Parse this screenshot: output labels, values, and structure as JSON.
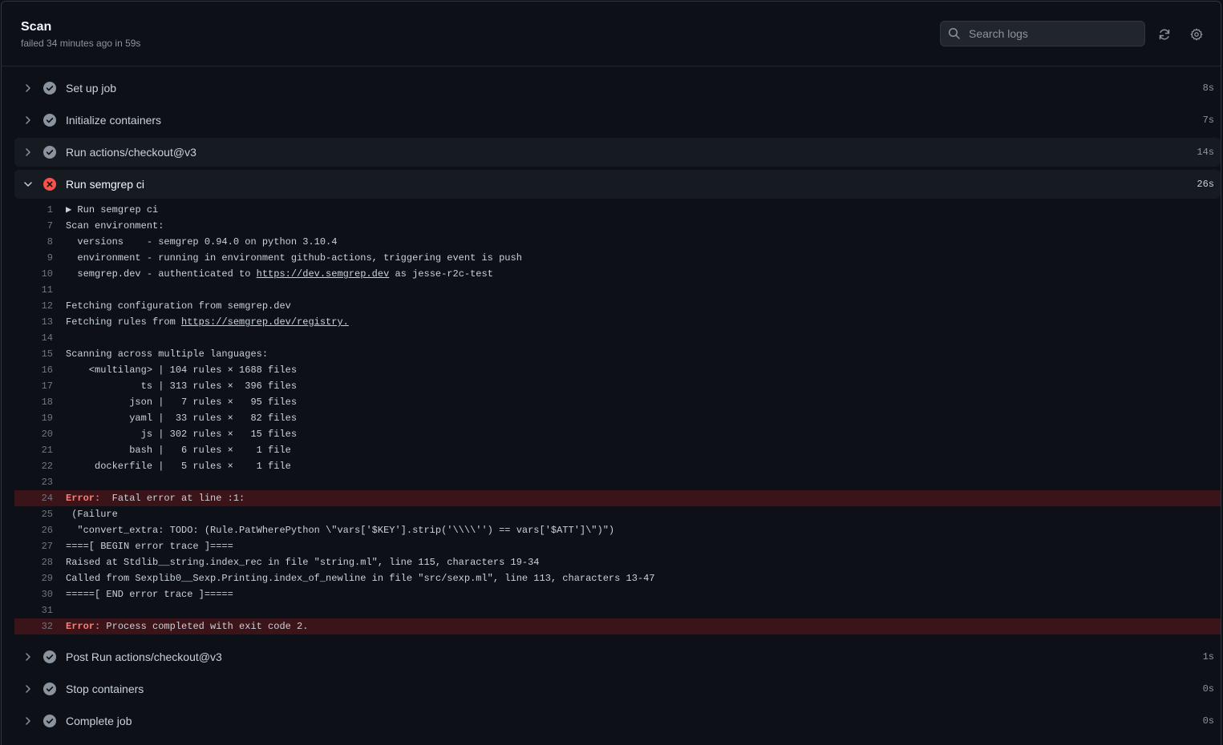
{
  "header": {
    "title": "Scan",
    "subtitle": "failed 34 minutes ago in 59s",
    "search_placeholder": "Search logs"
  },
  "colors": {
    "success": "#8b949e",
    "failure": "#f85149",
    "error_row": "#3b1419",
    "error_text": "#ff7b72"
  },
  "steps_before": [
    {
      "name": "Set up job",
      "duration": "8s",
      "status": "success"
    },
    {
      "name": "Initialize containers",
      "duration": "7s",
      "status": "success"
    },
    {
      "name": "Run actions/checkout@v3",
      "duration": "14s",
      "status": "success"
    }
  ],
  "open_step": {
    "name": "Run semgrep ci",
    "duration": "26s",
    "status": "failure"
  },
  "log_lines": [
    {
      "n": "1",
      "text": "▶ Run semgrep ci"
    },
    {
      "n": "7",
      "text": "Scan environment:"
    },
    {
      "n": "8",
      "text": "  versions    - semgrep 0.94.0 on python 3.10.4"
    },
    {
      "n": "9",
      "text": "  environment - running in environment github-actions, triggering event is push"
    },
    {
      "n": "10",
      "text": "  semgrep.dev - authenticated to ",
      "link": "https://dev.semgrep.dev",
      "after": " as jesse-r2c-test"
    },
    {
      "n": "11",
      "text": ""
    },
    {
      "n": "12",
      "text": "Fetching configuration from semgrep.dev"
    },
    {
      "n": "13",
      "text": "Fetching rules from ",
      "link": "https://semgrep.dev/registry.",
      "after": ""
    },
    {
      "n": "14",
      "text": ""
    },
    {
      "n": "15",
      "text": "Scanning across multiple languages:"
    },
    {
      "n": "16",
      "text": "    <multilang> | 104 rules × 1688 files"
    },
    {
      "n": "17",
      "text": "             ts | 313 rules ×  396 files"
    },
    {
      "n": "18",
      "text": "           json |   7 rules ×   95 files"
    },
    {
      "n": "19",
      "text": "           yaml |  33 rules ×   82 files"
    },
    {
      "n": "20",
      "text": "             js | 302 rules ×   15 files"
    },
    {
      "n": "21",
      "text": "           bash |   6 rules ×    1 file"
    },
    {
      "n": "22",
      "text": "     dockerfile |   5 rules ×    1 file"
    },
    {
      "n": "23",
      "text": ""
    },
    {
      "n": "24",
      "error": "Error:",
      "text": "  Fatal error at line :1:"
    },
    {
      "n": "25",
      "text": " (Failure"
    },
    {
      "n": "26",
      "text": "  \"convert_extra: TODO: (Rule.PatWherePython \\\"vars['$KEY'].strip('\\\\\\\\'') == vars['$ATT']\\\")\")"
    },
    {
      "n": "27",
      "text": "====[ BEGIN error trace ]===="
    },
    {
      "n": "28",
      "text": "Raised at Stdlib__string.index_rec in file \"string.ml\", line 115, characters 19-34"
    },
    {
      "n": "29",
      "text": "Called from Sexplib0__Sexp.Printing.index_of_newline in file \"src/sexp.ml\", line 113, characters 13-47"
    },
    {
      "n": "30",
      "text": "=====[ END error trace ]====="
    },
    {
      "n": "31",
      "text": ""
    },
    {
      "n": "32",
      "error": "Error:",
      "text": " Process completed with exit code 2."
    }
  ],
  "steps_after": [
    {
      "name": "Post Run actions/checkout@v3",
      "duration": "1s",
      "status": "success"
    },
    {
      "name": "Stop containers",
      "duration": "0s",
      "status": "success"
    },
    {
      "name": "Complete job",
      "duration": "0s",
      "status": "success"
    }
  ],
  "icons": {
    "search": "search-icon",
    "refresh": "refresh-icon",
    "settings": "gear-icon"
  }
}
